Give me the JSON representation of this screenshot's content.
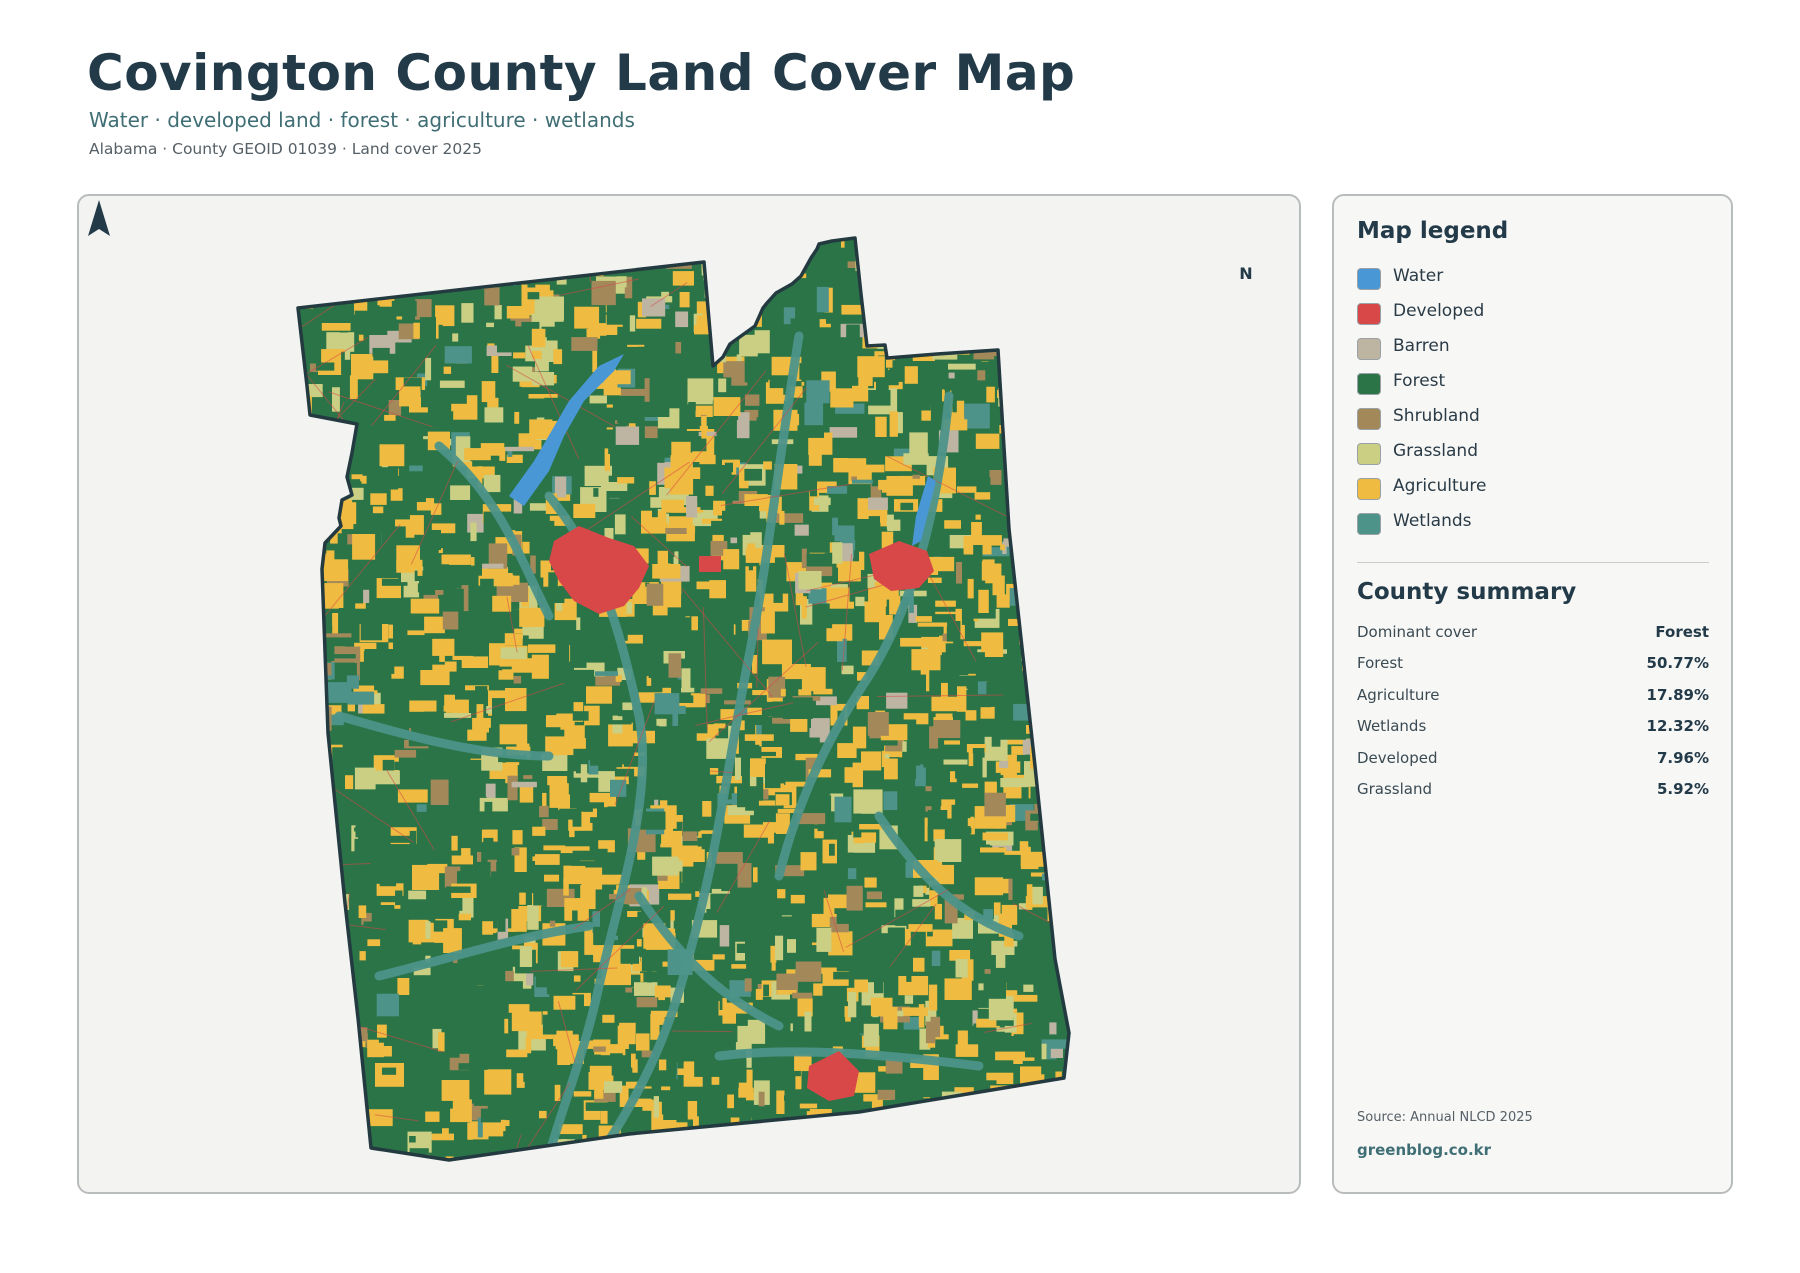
{
  "header": {
    "title": "Covington County Land Cover Map",
    "subtitle": "Water · developed land · forest · agriculture · wetlands",
    "meta": "Alabama · County GEOID 01039 · Land cover 2025"
  },
  "map": {
    "north_label": "N",
    "colors": {
      "Water": "#4a97d6",
      "Developed": "#d84848",
      "Barren": "#bdb5a2",
      "Forest": "#2a7447",
      "Shrubland": "#a3885a",
      "Grassland": "#cacf83",
      "Agriculture": "#efbb40",
      "Wetlands": "#4d938a",
      "outline": "#233a40"
    }
  },
  "legend": {
    "title": "Map legend",
    "items": [
      {
        "label": "Water",
        "color": "#4a97d6"
      },
      {
        "label": "Developed",
        "color": "#d84848"
      },
      {
        "label": "Barren",
        "color": "#bdb5a2"
      },
      {
        "label": "Forest",
        "color": "#2a7447"
      },
      {
        "label": "Shrubland",
        "color": "#a3885a"
      },
      {
        "label": "Grassland",
        "color": "#cacf83"
      },
      {
        "label": "Agriculture",
        "color": "#efbb40"
      },
      {
        "label": "Wetlands",
        "color": "#4d938a"
      }
    ]
  },
  "summary": {
    "title": "County summary",
    "rows": [
      {
        "label": "Dominant cover",
        "value": "Forest"
      },
      {
        "label": "Forest",
        "value": "50.77%"
      },
      {
        "label": "Agriculture",
        "value": "17.89%"
      },
      {
        "label": "Wetlands",
        "value": "12.32%"
      },
      {
        "label": "Developed",
        "value": "7.96%"
      },
      {
        "label": "Grassland",
        "value": "5.92%"
      }
    ]
  },
  "footer": {
    "source": "Source: Annual NLCD 2025",
    "site": "greenblog.co.kr"
  }
}
